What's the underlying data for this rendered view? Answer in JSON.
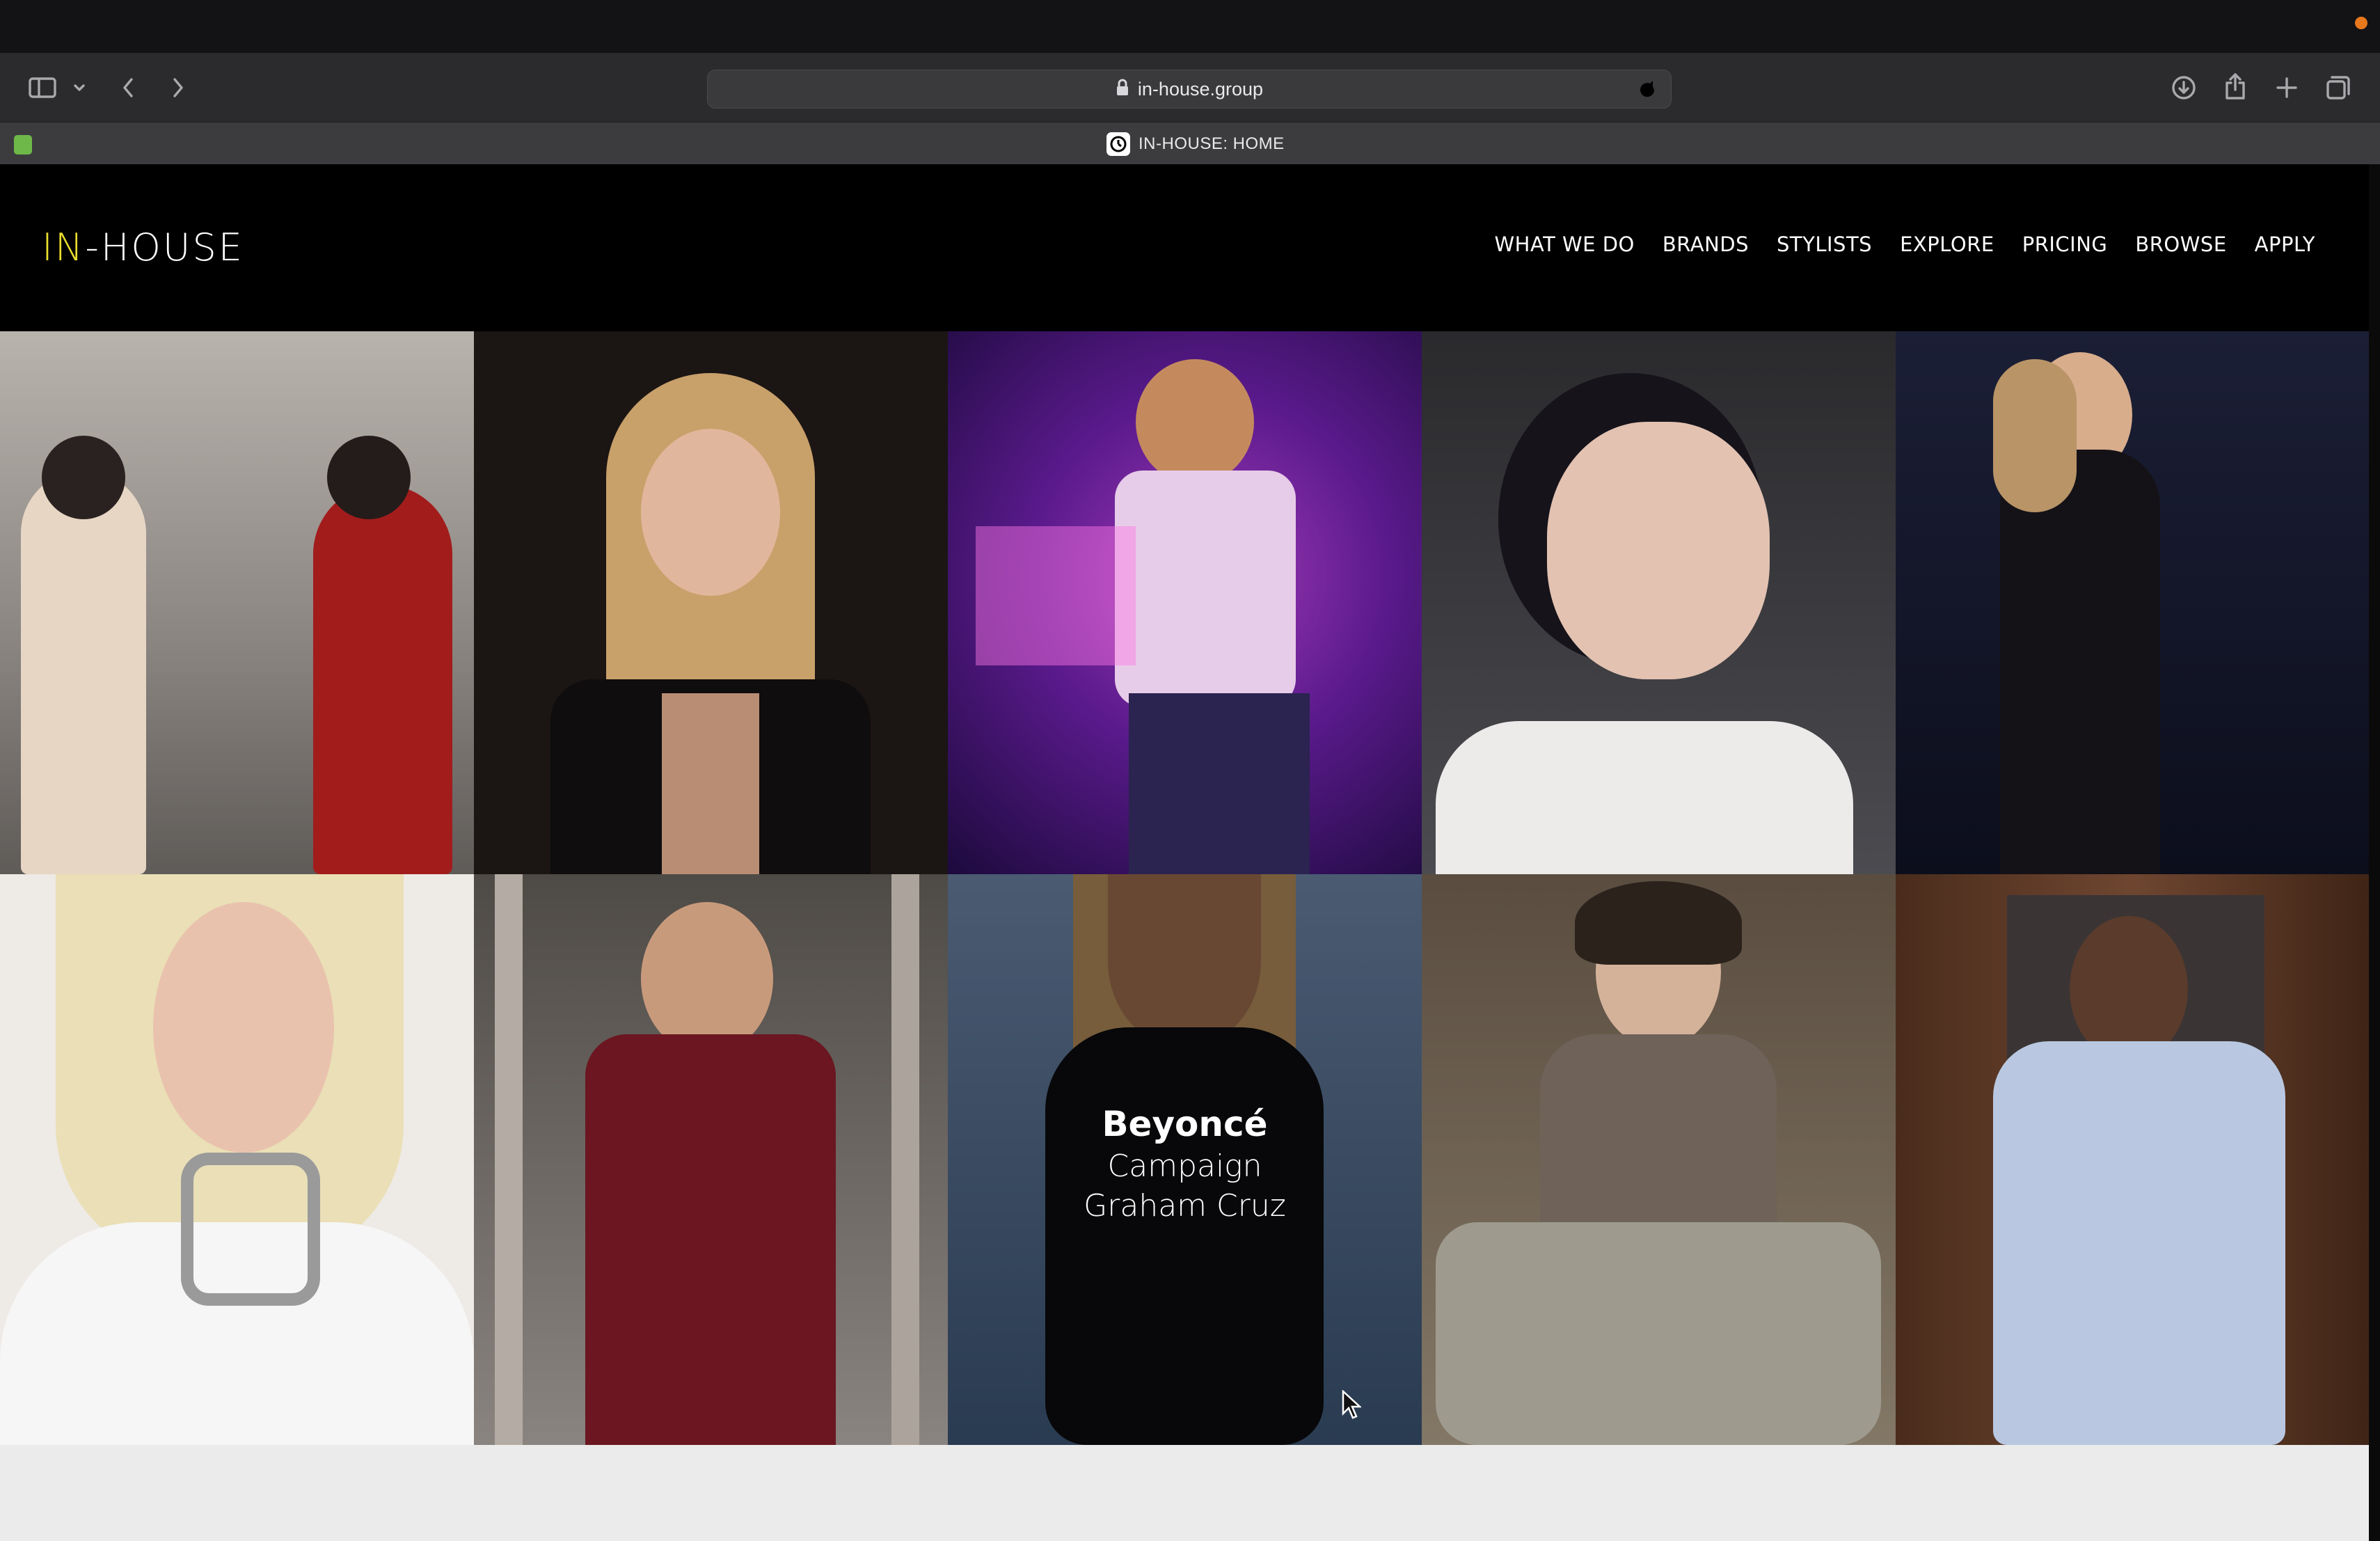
{
  "browser": {
    "url": "in-house.group",
    "tab_title": "IN-HOUSE: HOME",
    "toolbar_icons": [
      "sidebar-icon",
      "chevron-down-icon",
      "back-icon",
      "forward-icon",
      "download-icon",
      "share-icon",
      "new-tab-icon",
      "tab-overview-icon"
    ]
  },
  "site": {
    "logo_in": "IN",
    "logo_rest": "-HOUSE",
    "logo_accent": "#e8dd2d",
    "nav": [
      "WHAT WE DO",
      "BRANDS",
      "STYLISTS",
      "EXPLORE",
      "PRICING",
      "BROWSE",
      "APPLY"
    ]
  },
  "gallery": {
    "hovered_tile": {
      "name": "Beyoncé",
      "type": "Campaign",
      "stylist": "Graham Cruz"
    }
  }
}
